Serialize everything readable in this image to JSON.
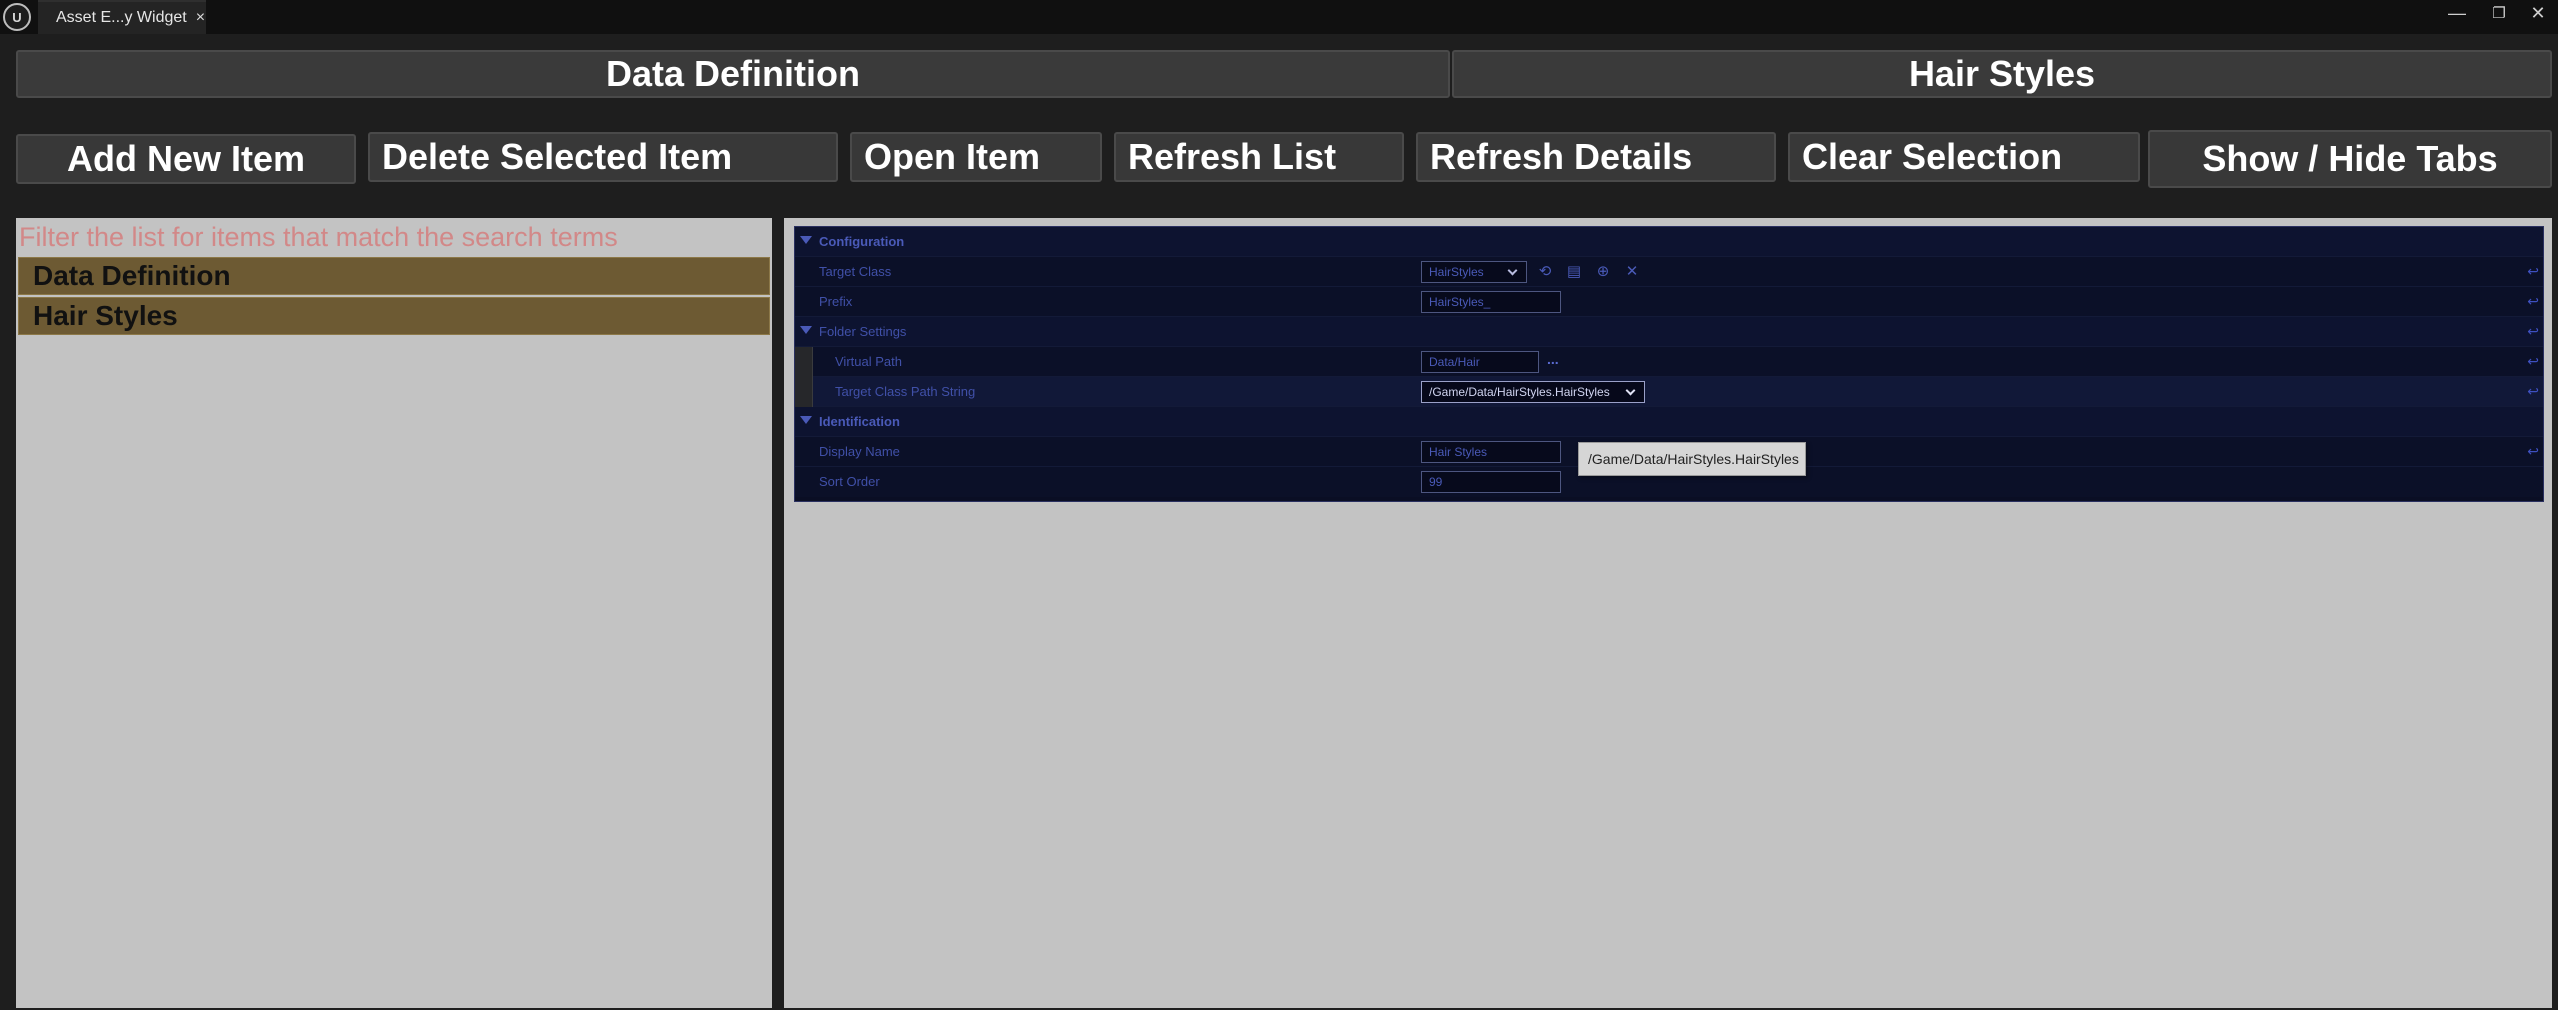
{
  "window": {
    "tab_title": "Asset E...y Widget",
    "tab_close": "×",
    "logo_text": "U",
    "minimize_glyph": "—",
    "restore_glyph": "❐",
    "close_glyph": "✕"
  },
  "header": {
    "left_title": "Data Definition",
    "right_title": "Hair Styles"
  },
  "toolbar": {
    "add": "Add New Item",
    "delete": "Delete Selected Item",
    "open": "Open Item",
    "refresh_list": "Refresh List",
    "refresh_details": "Refresh Details",
    "clear": "Clear Selection",
    "show_hide": "Show / Hide Tabs"
  },
  "list": {
    "search_placeholder": "Filter the list for items that match the search terms",
    "items": [
      {
        "label": "Data Definition"
      },
      {
        "label": "Hair Styles"
      }
    ]
  },
  "details": {
    "configuration": {
      "label": "Configuration",
      "target_class_label": "Target Class",
      "target_class_value": "HairStyles",
      "prefix_label": "Prefix",
      "prefix_value": "HairStyles_"
    },
    "folder_settings": {
      "label": "Folder Settings",
      "virtual_path_label": "Virtual Path",
      "virtual_path_value": "Data/Hair",
      "virtual_path_more": "...",
      "target_class_path_label": "Target Class Path String",
      "target_class_path_value": "/Game/Data/HairStyles.HairStyles"
    },
    "identification": {
      "label": "Identification",
      "display_name_label": "Display Name",
      "display_name_value": "Hair Styles",
      "sort_order_label": "Sort Order",
      "sort_order_value": "99"
    },
    "tooltip": "/Game/Data/HairStyles.HairStyles"
  },
  "colors": {
    "list_item_bg": "#6d5a33",
    "panel_bg": "#c3c3c3",
    "details_bg": "#0a0e24",
    "placeholder": "#d28888",
    "detail_accent": "#4a5ab8"
  }
}
